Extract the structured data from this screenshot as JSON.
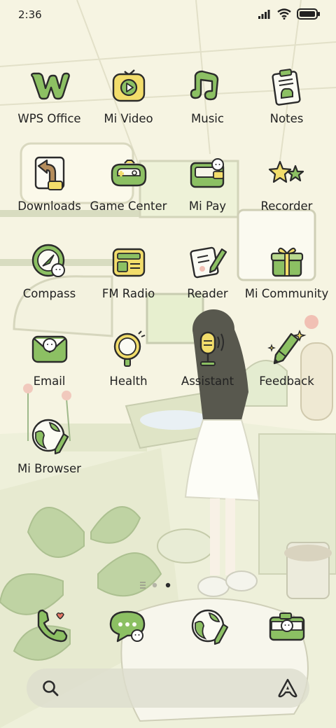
{
  "status_bar": {
    "time": "2:36",
    "icons": [
      "signal-icon",
      "wifi-icon",
      "battery-icon"
    ]
  },
  "apps": [
    {
      "label": "WPS Office",
      "icon": "wps-office-icon"
    },
    {
      "label": "Mi Video",
      "icon": "mi-video-icon"
    },
    {
      "label": "Music",
      "icon": "music-icon"
    },
    {
      "label": "Notes",
      "icon": "notes-icon"
    },
    {
      "label": "Downloads",
      "icon": "downloads-icon"
    },
    {
      "label": "Game Center",
      "icon": "game-center-icon"
    },
    {
      "label": "Mi Pay",
      "icon": "mi-pay-icon"
    },
    {
      "label": "Recorder",
      "icon": "recorder-icon"
    },
    {
      "label": "Compass",
      "icon": "compass-icon"
    },
    {
      "label": "FM Radio",
      "icon": "fm-radio-icon"
    },
    {
      "label": "Reader",
      "icon": "reader-icon"
    },
    {
      "label": "Mi Community",
      "icon": "mi-community-icon"
    },
    {
      "label": "Email",
      "icon": "email-icon"
    },
    {
      "label": "Health",
      "icon": "health-icon"
    },
    {
      "label": "Assistant",
      "icon": "assistant-icon"
    },
    {
      "label": "Feedback",
      "icon": "feedback-icon"
    },
    {
      "label": "Mi Browser",
      "icon": "mi-browser-icon"
    }
  ],
  "pager": {
    "pages": 2,
    "current_page": 2
  },
  "dock": [
    {
      "icon": "phone-icon"
    },
    {
      "icon": "messages-icon"
    },
    {
      "icon": "browser-icon"
    },
    {
      "icon": "camera-icon"
    }
  ],
  "search_bar": {
    "left_icon": "search-icon",
    "right_icon": "assistant-a-icon"
  },
  "colors": {
    "background": "#f6f4e2",
    "accent_green": "#8cc063",
    "dark_green": "#5d9440",
    "accent_yellow": "#f2dd6b",
    "outline": "#2b2b2b"
  }
}
